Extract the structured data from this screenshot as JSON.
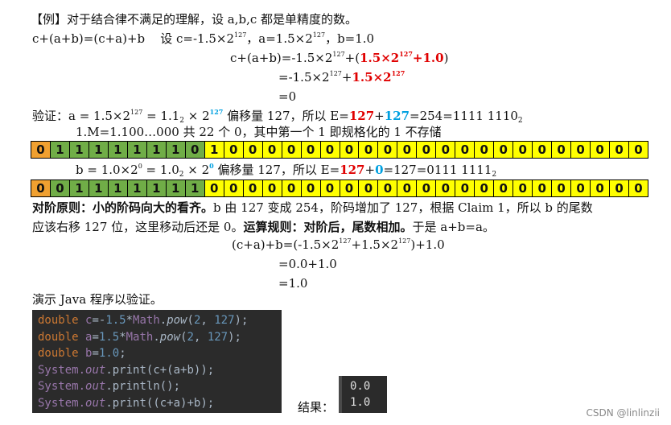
{
  "line1": {
    "bracket": "【例】",
    "text": "对于结合律不满足的理解，设 a,b,c 都是单精度的数。"
  },
  "line2": {
    "eq": "c+(a+b)=(c+a)+b",
    "c_pre": "设 c=-1.5×2",
    "c_exp": "127",
    "a_pre": "，a=1.5×2",
    "a_exp": "127",
    "b_txt": "，b=1.0"
  },
  "line3": {
    "pre": "c+(a+b)=-1.5×2",
    "exp": "127",
    "plus": "+(",
    "red": "1.5×2",
    "red_exp": "127",
    "red2": "+1.0",
    "close": ")"
  },
  "line4": {
    "pre": "=-1.5×2",
    "exp": "127",
    "plus": "+",
    "red": "1.5×2",
    "red_exp": "127"
  },
  "line5": {
    "text": "=0"
  },
  "verify": {
    "pre": "验证：a = 1.5×2",
    "exp": "127",
    "mid": " = 1.1",
    "sub": "2",
    "x": " × 2",
    "exp2": "127",
    "post": " 偏移量 127，所以 E=",
    "r1": "127",
    "plus": "+",
    "r2": "127",
    "end": "=254=1111 1110",
    "end_sub": "2"
  },
  "mantissa_note": "1.M=1.100…000 共 22 个 0，其中第一个 1 即规格化的 1 不存储",
  "row_a_bits": {
    "sign": [
      "0"
    ],
    "exponent": [
      "1",
      "1",
      "1",
      "1",
      "1",
      "1",
      "1",
      "0"
    ],
    "mantissa": [
      "1",
      "0",
      "0",
      "0",
      "0",
      "0",
      "0",
      "0",
      "0",
      "0",
      "0",
      "0",
      "0",
      "0",
      "0",
      "0",
      "0",
      "0",
      "0",
      "0",
      "0",
      "0",
      "0"
    ]
  },
  "b_line": {
    "pre": "b = 1.0×2",
    "exp": "0",
    "mid": " = 1.0",
    "sub": "2",
    "x": " × 2",
    "exp2": "0",
    "post": " 偏移量 127，所以 E=",
    "r1": "127",
    "plus": "+",
    "c1": "0",
    "end": "=127=0111 1111",
    "end_sub": "2"
  },
  "row_b_bits": {
    "sign": [
      "0"
    ],
    "exponent": [
      "0",
      "1",
      "1",
      "1",
      "1",
      "1",
      "1",
      "1"
    ],
    "mantissa": [
      "0",
      "0",
      "0",
      "0",
      "0",
      "0",
      "0",
      "0",
      "0",
      "0",
      "0",
      "0",
      "0",
      "0",
      "0",
      "0",
      "0",
      "0",
      "0",
      "0",
      "0",
      "0",
      "0"
    ]
  },
  "principle": {
    "bold1": "对阶原则：小的阶码向大的看齐。",
    "text1": "b 由 127 变成 254，阶码增加了 127，根据 Claim 1，所以 b 的尾数",
    "text2a": "应该右移 127 位，这里移动后还是 0。",
    "bold2": "运算规则：对阶后，尾数相加。",
    "text2b": "于是 a+b=a。"
  },
  "calc1": {
    "pre": "(c+a)+b=(-1.5×2",
    "exp1": "127",
    "mid": "+1.5×2",
    "exp2": "127",
    "post": ")+1.0"
  },
  "calc2": "=0.0+1.0",
  "calc3": "=1.0",
  "demo": "演示 Java 程序以验证。",
  "code": {
    "l1": {
      "kw": "double ",
      "var": "c",
      "eq": "=-",
      "n1": "1.5",
      "op": "*",
      "cls": "Math",
      "dot": ".",
      "fn": "pow",
      "open": "(",
      "n2": "2",
      "comma": ", ",
      "n3": "127",
      "close": ");"
    },
    "l2": {
      "kw": "double ",
      "var": "a",
      "eq": "=",
      "n1": "1.5",
      "op": "*",
      "cls": "Math",
      "dot": ".",
      "fn": "pow",
      "open": "(",
      "n2": "2",
      "comma": ", ",
      "n3": "127",
      "close": ");"
    },
    "l3": {
      "kw": "double ",
      "var": "b",
      "eq": "=",
      "n1": "1.0",
      "close": ";"
    },
    "l4": {
      "sys": "System.",
      "out": "out",
      "rest": ".print(c+(a+b));"
    },
    "l5": {
      "sys": "System.",
      "out": "out",
      "rest": ".println();"
    },
    "l6": {
      "sys": "System.",
      "out": "out",
      "rest": ".print((c+a)+b);"
    }
  },
  "result_label": "结果：",
  "output": [
    "0.0",
    "1.0"
  ],
  "watermark": "CSDN @linlinzii"
}
